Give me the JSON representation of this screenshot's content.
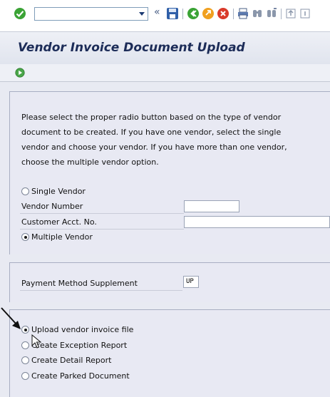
{
  "toolbar": {
    "icons": [
      "enter-checkmark-icon",
      "command-field-dropdown",
      "back-chevrons-icon",
      "save-icon",
      "back-icon",
      "exit-icon",
      "cancel-icon",
      "print-icon",
      "find-icon",
      "find-next-icon",
      "first-page-icon",
      "next-page-icon"
    ]
  },
  "window": {
    "title": "Vendor Invoice Document Upload"
  },
  "instructions": "Please select the proper radio button based on the type of vendor document to be created.  If you have one vendor, select the single vendor and choose your vendor.  If you have more than one vendor, choose the multiple vendor option.",
  "vendor_section": {
    "single_vendor_label": "Single Vendor",
    "vendor_number_label": "Vendor Number",
    "vendor_number_value": "",
    "customer_acct_label": "Customer Acct. No.",
    "customer_acct_value": "",
    "multiple_vendor_label": "Multiple Vendor",
    "selected": "Multiple Vendor"
  },
  "payment_section": {
    "label": "Payment Method Supplement",
    "value": "UP"
  },
  "options_section": {
    "options": [
      "Upload vendor invoice file",
      "Create Exception Report",
      "Create Detail Report",
      "Create Parked Document"
    ],
    "selected": "Upload vendor invoice file"
  },
  "colors": {
    "title_text": "#1c2c58",
    "panel_bg": "#e8e9f3",
    "toolbar_green": "#3aa335",
    "toolbar_orange": "#f0a020",
    "toolbar_red": "#d93a2a"
  }
}
